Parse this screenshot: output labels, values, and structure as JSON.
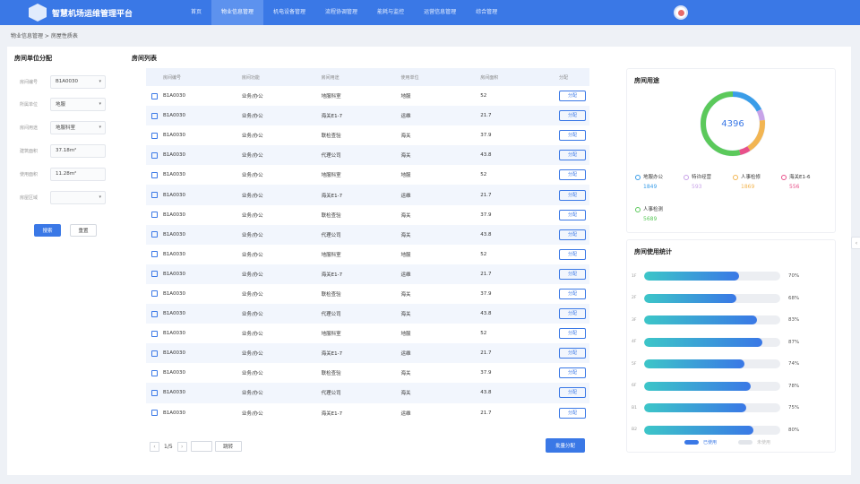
{
  "app": {
    "title": "智慧机场运维管理平台",
    "nav": [
      "首页",
      "物业信息管理",
      "机电设备管理",
      "流程协调管理",
      "能耗与监控",
      "运营信息管理",
      "综合管理"
    ],
    "active_nav_index": 1
  },
  "breadcrumb": "物业信息管理 > 房屋性质表",
  "filter": {
    "title": "房间单位分配",
    "fields": [
      {
        "label": "房间编号",
        "value": "B1A0030",
        "type": "select"
      },
      {
        "label": "所属单位",
        "value": "地服",
        "type": "select"
      },
      {
        "label": "房间用途",
        "value": "地服科室",
        "type": "select"
      },
      {
        "label": "建筑面积",
        "value": "37.18m²",
        "type": "input"
      },
      {
        "label": "使用面积",
        "value": "11.28m²",
        "type": "input"
      },
      {
        "label": "房屋区域",
        "value": "",
        "type": "select"
      }
    ],
    "search_label": "搜索",
    "reset_label": "重置"
  },
  "list": {
    "title": "房间列表",
    "columns": [
      "房间编号",
      "房间功能",
      "房间用途",
      "使用单位",
      "房间面积",
      "分配"
    ],
    "assign_label": "分配",
    "rows": [
      [
        "B1A0030",
        "业务/办公",
        "地服科室",
        "地服",
        "52"
      ],
      [
        "B1A0030",
        "业务/办公",
        "海关E1-7",
        "运维",
        "21.7"
      ],
      [
        "B1A0030",
        "业务/办公",
        "联检查验",
        "海关",
        "37.9"
      ],
      [
        "B1A0030",
        "业务/办公",
        "代理公司",
        "海关",
        "43.8"
      ],
      [
        "B1A0030",
        "业务/办公",
        "地服科室",
        "地服",
        "52"
      ],
      [
        "B1A0030",
        "业务/办公",
        "海关E1-7",
        "运维",
        "21.7"
      ],
      [
        "B1A0030",
        "业务/办公",
        "联检查验",
        "海关",
        "37.9"
      ],
      [
        "B1A0030",
        "业务/办公",
        "代理公司",
        "海关",
        "43.8"
      ],
      [
        "B1A0030",
        "业务/办公",
        "地服科室",
        "地服",
        "52"
      ],
      [
        "B1A0030",
        "业务/办公",
        "海关E1-7",
        "运维",
        "21.7"
      ],
      [
        "B1A0030",
        "业务/办公",
        "联检查验",
        "海关",
        "37.9"
      ],
      [
        "B1A0030",
        "业务/办公",
        "代理公司",
        "海关",
        "43.8"
      ],
      [
        "B1A0030",
        "业务/办公",
        "地服科室",
        "地服",
        "52"
      ],
      [
        "B1A0030",
        "业务/办公",
        "海关E1-7",
        "运维",
        "21.7"
      ],
      [
        "B1A0030",
        "业务/办公",
        "联检查验",
        "海关",
        "37.9"
      ],
      [
        "B1A0030",
        "业务/办公",
        "代理公司",
        "海关",
        "43.8"
      ],
      [
        "B1A0030",
        "业务/办公",
        "海关E1-7",
        "运维",
        "21.7"
      ]
    ],
    "pagination": {
      "page_text": "1/5",
      "jump_label": "跳转"
    },
    "batch_label": "批量分配"
  },
  "usage": {
    "title": "房间用途",
    "total": "4396",
    "items": [
      {
        "label": "地服办公",
        "value": "1849",
        "color": "#3a9de8"
      },
      {
        "label": "特许经营",
        "value": "593",
        "color": "#c8a3e8"
      },
      {
        "label": "人事检修",
        "value": "1869",
        "color": "#f2b552"
      },
      {
        "label": "海关E1-6",
        "value": "556",
        "color": "#e8508a"
      },
      {
        "label": "人事检测",
        "value": "5689",
        "color": "#5bc95b"
      }
    ]
  },
  "usage_stats": {
    "title": "房间使用统计",
    "used_label": "已使用",
    "unused_label": "未使用",
    "used_color": "#3a78e6",
    "unused_color": "#e2e5ea",
    "rows": [
      {
        "label": "1F",
        "pct": "70%",
        "value": 0.7
      },
      {
        "label": "2F",
        "pct": "68%",
        "value": 0.68
      },
      {
        "label": "3F",
        "pct": "83%",
        "value": 0.83
      },
      {
        "label": "4F",
        "pct": "87%",
        "value": 0.87
      },
      {
        "label": "5F",
        "pct": "74%",
        "value": 0.74
      },
      {
        "label": "6F",
        "pct": "78%",
        "value": 0.78
      },
      {
        "label": "B1",
        "pct": "75%",
        "value": 0.75
      },
      {
        "label": "B2",
        "pct": "80%",
        "value": 0.8
      }
    ]
  }
}
